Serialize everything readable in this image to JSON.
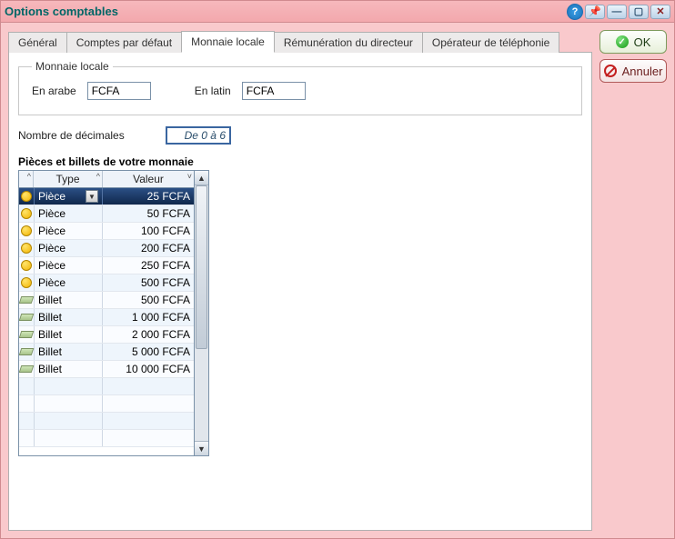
{
  "window": {
    "title": "Options comptables"
  },
  "title_buttons": {
    "help": "?",
    "pin": "📌",
    "min": "—",
    "max": "▢",
    "close": "✕"
  },
  "tabs": [
    {
      "label": "Général"
    },
    {
      "label": "Comptes par défaut"
    },
    {
      "label": "Monnaie locale"
    },
    {
      "label": "Rémunération du directeur"
    },
    {
      "label": "Opérateur de téléphonie"
    }
  ],
  "group": {
    "legend": "Monnaie locale",
    "arabic_label": "En arabe",
    "arabic_value": "FCFA",
    "latin_label": "En latin",
    "latin_value": "FCFA"
  },
  "decimals": {
    "label": "Nombre de décimales",
    "value": "De 0 à 6"
  },
  "denoms": {
    "header": "Pièces et billets de votre monnaie",
    "col_type": "Type",
    "col_value": "Valeur",
    "rows": [
      {
        "kind": "coin",
        "type": "Pièce",
        "value": "25 FCFA",
        "selected": true
      },
      {
        "kind": "coin",
        "type": "Pièce",
        "value": "50 FCFA"
      },
      {
        "kind": "coin",
        "type": "Pièce",
        "value": "100 FCFA"
      },
      {
        "kind": "coin",
        "type": "Pièce",
        "value": "200 FCFA"
      },
      {
        "kind": "coin",
        "type": "Pièce",
        "value": "250 FCFA"
      },
      {
        "kind": "coin",
        "type": "Pièce",
        "value": "500 FCFA"
      },
      {
        "kind": "bill",
        "type": "Billet",
        "value": "500 FCFA"
      },
      {
        "kind": "bill",
        "type": "Billet",
        "value": "1 000 FCFA"
      },
      {
        "kind": "bill",
        "type": "Billet",
        "value": "2 000 FCFA"
      },
      {
        "kind": "bill",
        "type": "Billet",
        "value": "5 000 FCFA"
      },
      {
        "kind": "bill",
        "type": "Billet",
        "value": "10 000 FCFA"
      }
    ],
    "empty_rows": 4
  },
  "buttons": {
    "ok": "OK",
    "cancel": "Annuler"
  }
}
